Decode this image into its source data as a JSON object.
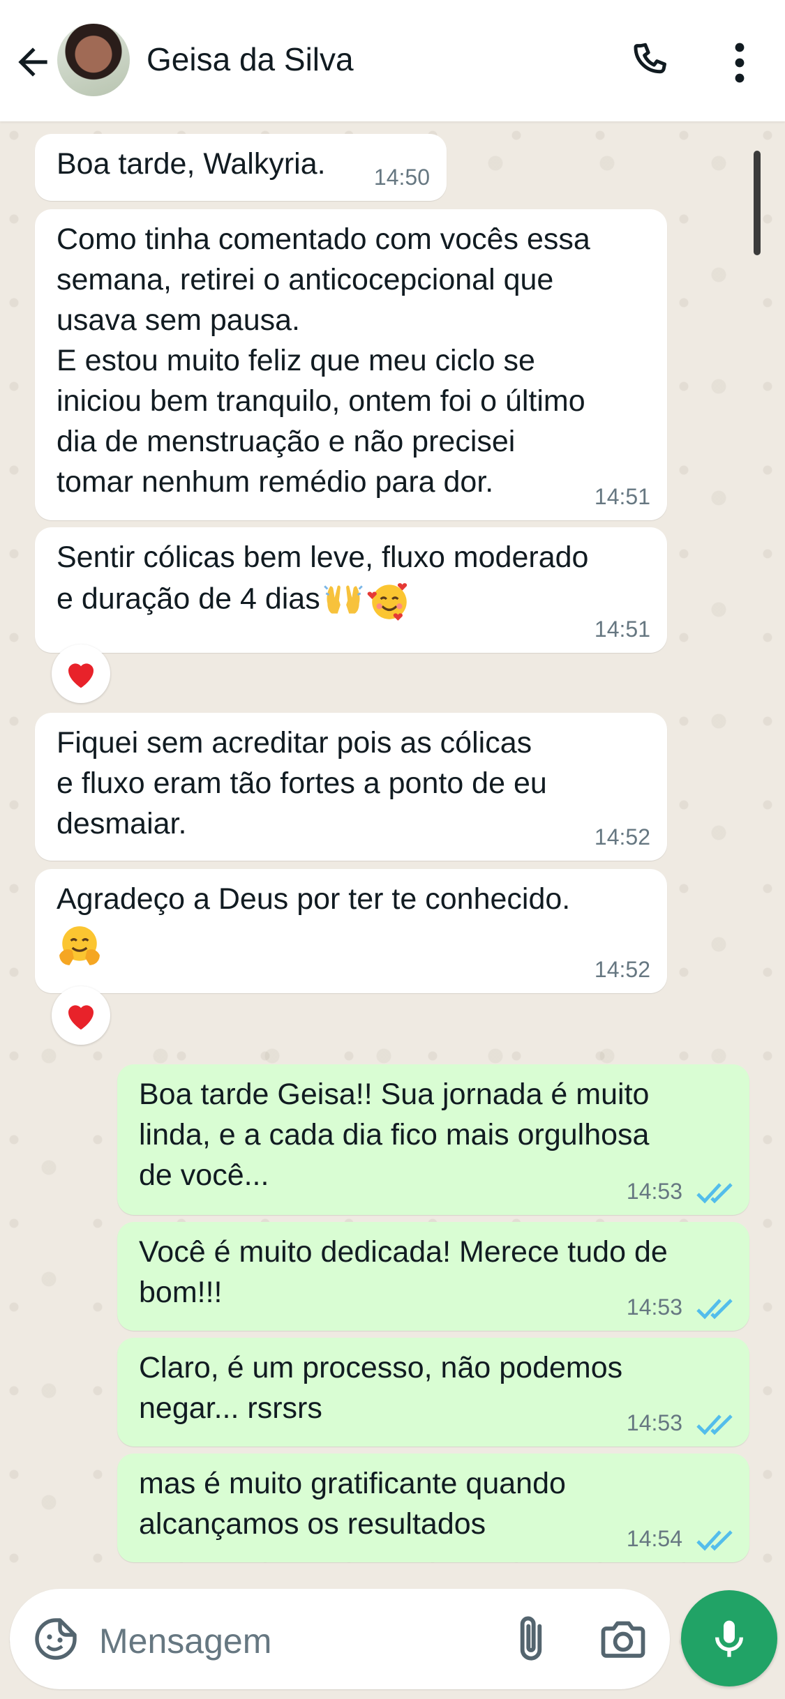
{
  "header": {
    "contact_name": "Geisa da Silva",
    "back_icon": "arrow-left-icon",
    "call_icon": "phone-icon",
    "menu_icon": "more-vertical-icon"
  },
  "messages": [
    {
      "direction": "incoming",
      "text": "Boa tarde, Walkyria.",
      "time": "14:50"
    },
    {
      "direction": "incoming",
      "text": "Como tinha comentado com vocês essa\nsemana, retirei o anticocepcional que\nusava sem pausa.\nE estou muito feliz que meu ciclo se\niniciou bem tranquilo, ontem foi o último\ndia de menstruação e não precisei\ntomar nenhum remédio para dor.",
      "time": "14:51"
    },
    {
      "direction": "incoming",
      "text": "Sentir cólicas bem leve, fluxo moderado\ne duração de 4 dias",
      "emojis": [
        "raising-hands-icon",
        "smiling-face-with-hearts-icon"
      ],
      "time": "14:51",
      "reaction": "heart-icon"
    },
    {
      "direction": "incoming",
      "text": "Fiquei sem acreditar pois as cólicas\ne fluxo eram tão fortes a ponto de eu\ndesmaiar.",
      "time": "14:52"
    },
    {
      "direction": "incoming",
      "text": "Agradeço a Deus por ter te conhecido.",
      "emojis": [
        "hugging-face-icon"
      ],
      "time": "14:52",
      "reaction": "heart-icon"
    },
    {
      "direction": "outgoing",
      "text": "Boa tarde Geisa!! Sua jornada é muito\nlinda, e a cada dia fico mais orgulhosa\nde você...",
      "time": "14:53",
      "status": "read"
    },
    {
      "direction": "outgoing",
      "text": "Você é muito dedicada! Merece tudo de\nbom!!!",
      "time": "14:53",
      "status": "read"
    },
    {
      "direction": "outgoing",
      "text": "Claro, é um processo, não podemos\nnegar... rsrsrs",
      "time": "14:53",
      "status": "read"
    },
    {
      "direction": "outgoing",
      "text": "mas é muito gratificante quando\nalcançamos os resultados",
      "time": "14:54",
      "status": "read"
    }
  ],
  "input": {
    "placeholder": "Mensagem",
    "value": "",
    "sticker_icon": "sticker-icon",
    "attach_icon": "paperclip-icon",
    "camera_icon": "camera-icon",
    "mic_icon": "microphone-icon"
  },
  "colors": {
    "incoming_bubble": "#ffffff",
    "outgoing_bubble": "#d9fdd3",
    "accent_green": "#21a366",
    "read_ticks": "#53bdeb",
    "wallpaper": "#efeae2"
  }
}
